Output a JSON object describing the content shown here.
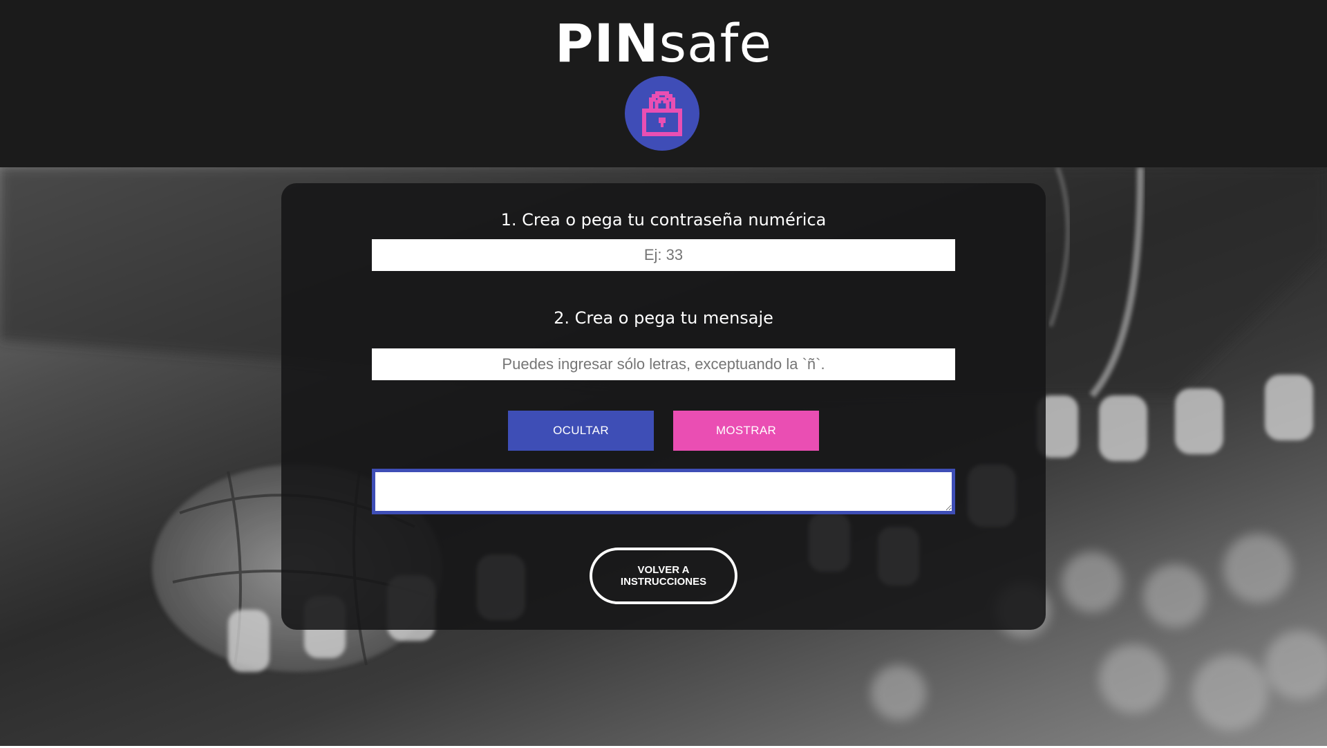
{
  "app": {
    "brand_bold": "PIN",
    "brand_light": "safe"
  },
  "icons": {
    "logo": "lock-icon"
  },
  "colors": {
    "header_bg": "#1b1b1b",
    "logo_circle": "#3f4db7",
    "lock_color": "#e94fb3",
    "hide_button": "#3e4eb6",
    "show_button": "#ea4eb3",
    "output_border": "#3e4eb6"
  },
  "form": {
    "step1_label": "1. Crea o pega tu contraseña numérica",
    "pin_placeholder": "Ej: 33",
    "pin_value": "",
    "step2_label": "2. Crea o pega tu mensaje",
    "message_placeholder": "Puedes ingresar sólo letras, exceptuando la `ñ`.",
    "message_value": "",
    "hide_label": "OCULTAR",
    "show_label": "MOSTRAR",
    "output_value": ""
  },
  "nav": {
    "back_label": "VOLVER A INSTRUCCIONES"
  }
}
